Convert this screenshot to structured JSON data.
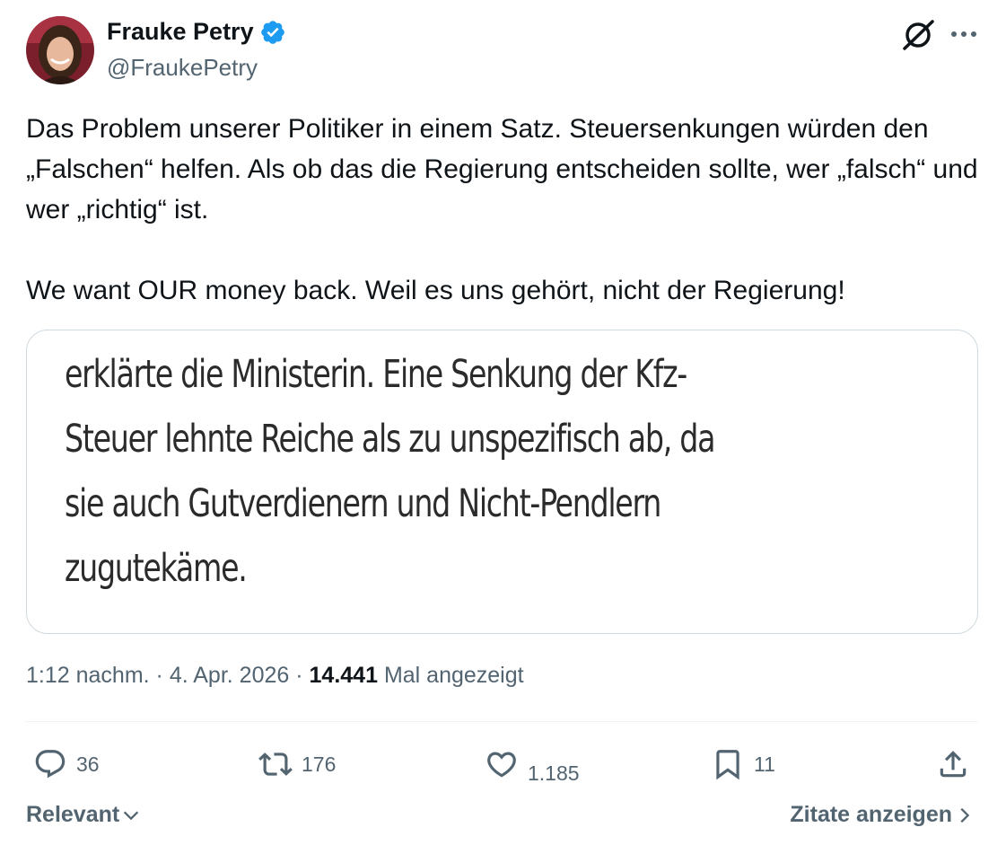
{
  "author": {
    "name": "Frauke Petry",
    "handle": "@FraukePetry"
  },
  "tweet": {
    "paragraph1": "Das Problem unserer Politiker in einem Satz. Steuersenkungen würden den „Falschen“ helfen. Als ob das die Regierung entscheiden sollte, wer „falsch“ und wer „richtig“ ist.",
    "paragraph2": "We want OUR money back. Weil es uns gehört, nicht der Regierung!"
  },
  "media": {
    "lines": [
      "erklärte die Ministerin. Eine Senkung der Kfz-",
      "Steuer lehnte Reiche als zu unspezifisch ab, da",
      "sie auch Gutverdienern und Nicht-Pendlern",
      "zugutekäme."
    ]
  },
  "meta": {
    "time": "1:12 nachm.",
    "separator": "·",
    "date": "4. Apr. 2026",
    "views": "14.441",
    "views_label": "Mal angezeigt"
  },
  "actions": {
    "replies": "36",
    "reposts": "176",
    "likes": "1.185",
    "bookmarks": "11"
  },
  "footer": {
    "sort_label": "Relevant",
    "quotes_label": "Zitate anzeigen"
  },
  "colors": {
    "text": "#0f1419",
    "secondary": "#536471",
    "verified": "#1d9bf0",
    "border": "#cfd9de"
  },
  "icons": [
    "verified-badge-icon",
    "grok-icon",
    "more-icon",
    "reply-icon",
    "repost-icon",
    "like-icon",
    "bookmark-icon",
    "share-icon",
    "chevron-down-icon",
    "chevron-right-icon"
  ]
}
